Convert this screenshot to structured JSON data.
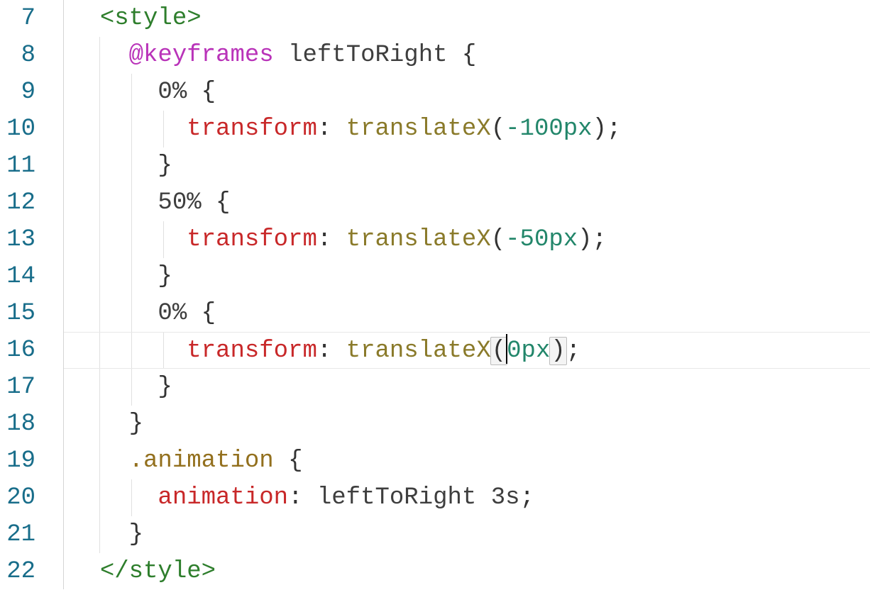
{
  "lineNumbers": [
    "7",
    "8",
    "9",
    "10",
    "11",
    "12",
    "13",
    "14",
    "15",
    "16",
    "17",
    "18",
    "19",
    "20",
    "21",
    "22"
  ],
  "code": {
    "l7": {
      "styleOpen": "<style>"
    },
    "l8": {
      "atrule": "@keyframes",
      "name": "leftToRight",
      "brace": "{"
    },
    "l9": {
      "pct": "0%",
      "brace": "{"
    },
    "l10": {
      "prop": "transform",
      "colon": ":",
      "func": "translateX",
      "lp": "(",
      "val": "-100px",
      "rp": ")",
      "semi": ";"
    },
    "l11": {
      "brace": "}"
    },
    "l12": {
      "pct": "50%",
      "brace": "{"
    },
    "l13": {
      "prop": "transform",
      "colon": ":",
      "func": "translateX",
      "lp": "(",
      "val": "-50px",
      "rp": ")",
      "semi": ";"
    },
    "l14": {
      "brace": "}"
    },
    "l15": {
      "pct": "0%",
      "brace": "{"
    },
    "l16": {
      "prop": "transform",
      "colon": ":",
      "func": "translateX",
      "lp": "(",
      "val": "0px",
      "rp": ")",
      "semi": ";"
    },
    "l17": {
      "brace": "}"
    },
    "l18": {
      "brace": "}"
    },
    "l19": {
      "sel": ".animation",
      "brace": "{"
    },
    "l20": {
      "prop": "animation",
      "colon": ":",
      "val": "leftToRight 3s",
      "semi": ";"
    },
    "l21": {
      "brace": "}"
    },
    "l22": {
      "styleClose": "</style>"
    }
  }
}
